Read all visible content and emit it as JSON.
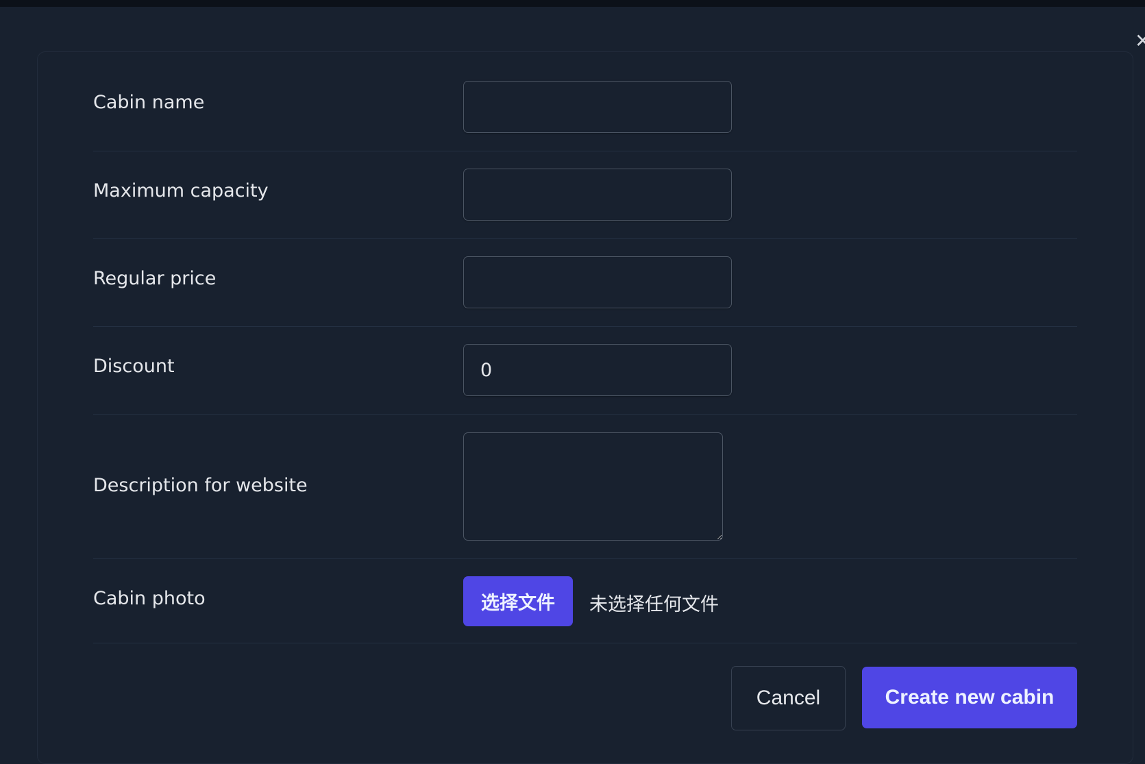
{
  "form": {
    "fields": [
      {
        "label": "Cabin name",
        "value": ""
      },
      {
        "label": "Maximum capacity",
        "value": ""
      },
      {
        "label": "Regular price",
        "value": ""
      },
      {
        "label": "Discount",
        "value": "0"
      },
      {
        "label": "Description for website",
        "value": ""
      },
      {
        "label": "Cabin photo"
      }
    ],
    "file_button_label": "选择文件",
    "file_status": "未选择任何文件"
  },
  "actions": {
    "cancel_label": "Cancel",
    "create_label": "Create new cabin"
  },
  "icons": {
    "close": "close-icon"
  },
  "colors": {
    "background": "#18212f",
    "accent": "#4f46e5",
    "border": "#4b5563",
    "divider": "#243042"
  }
}
